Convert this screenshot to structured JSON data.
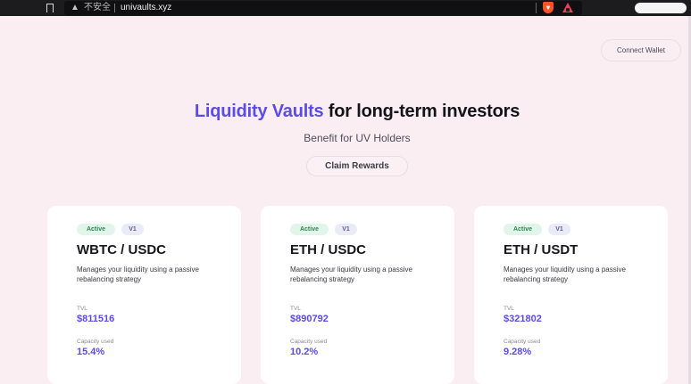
{
  "browser": {
    "insecure_label": "不安全",
    "url": "univaults.xyz"
  },
  "header": {
    "connect_wallet_label": "Connect Wallet"
  },
  "hero": {
    "title_accent": "Liquidity Vaults",
    "title_rest": " for long-term investors",
    "subtitle": "Benefit for UV Holders",
    "claim_rewards_label": "Claim Rewards"
  },
  "vaults": [
    {
      "status": "Active",
      "version": "V1",
      "pair": "WBTC / USDC",
      "description": "Manages your liquidity using a passive rebalancing strategy",
      "tvl_label": "TVL",
      "tvl": "$811516",
      "capacity_label": "Capacity used",
      "capacity": "15.4%"
    },
    {
      "status": "Active",
      "version": "V1",
      "pair": "ETH / USDC",
      "description": "Manages your liquidity using a passive rebalancing strategy",
      "tvl_label": "TVL",
      "tvl": "$890792",
      "capacity_label": "Capacity used",
      "capacity": "10.2%"
    },
    {
      "status": "Active",
      "version": "V1",
      "pair": "ETH / USDT",
      "description": "Manages your liquidity using a passive rebalancing strategy",
      "tvl_label": "TVL",
      "tvl": "$321802",
      "capacity_label": "Capacity used",
      "capacity": "9.28%"
    }
  ],
  "colors": {
    "accent": "#5a4bea",
    "page_background": "#fbeef3",
    "active_badge": "#2f8655"
  }
}
